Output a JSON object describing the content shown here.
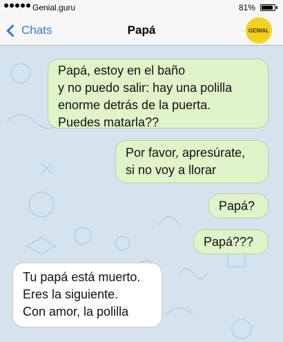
{
  "status_bar": {
    "carrier": "Genial.guru",
    "battery": "81%"
  },
  "nav": {
    "back_label": "Chats",
    "title": "Papá",
    "avatar_text": "GENIAL",
    "avatar_color": "#f3d21e"
  },
  "messages": [
    {
      "side": "out",
      "lines": [
        "Papá, estoy en el baño",
        "y no puedo salir: hay una polilla",
        "enorme detrás de la puerta.",
        "Puedes matarla??"
      ]
    },
    {
      "side": "out",
      "lines": [
        "Por favor, apresúrate,",
        "si no voy a llorar"
      ]
    },
    {
      "side": "out",
      "lines": [
        "Papá?"
      ]
    },
    {
      "side": "out",
      "lines": [
        "Papá???"
      ]
    },
    {
      "side": "in",
      "lines": [
        "Tu papá está muerto.",
        "Eres la siguiente.",
        "Con amor, la polilla"
      ]
    }
  ],
  "colors": {
    "chat_background": "#d5e3ee",
    "outgoing_bubble": "#dff5c9",
    "incoming_bubble": "#ffffff",
    "accent": "#2f7bd2"
  }
}
